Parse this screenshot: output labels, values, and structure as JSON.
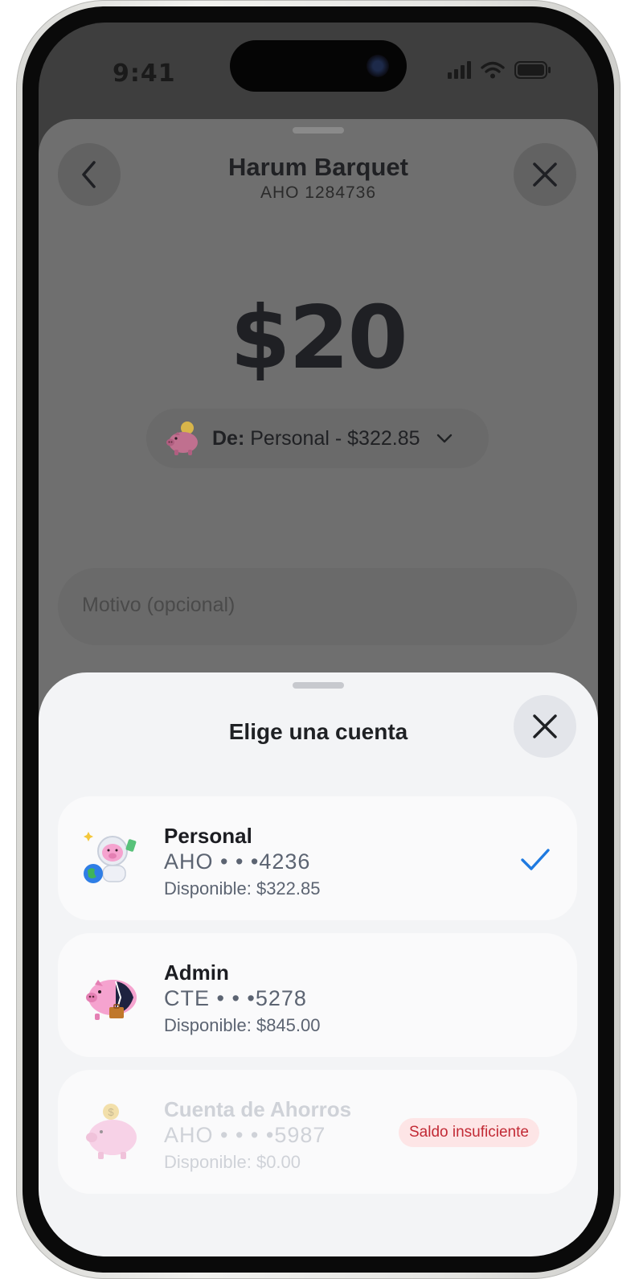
{
  "status_bar": {
    "time": "9:41"
  },
  "header": {
    "recipient_name": "Harum Barquet",
    "recipient_account": "AHO 1284736"
  },
  "transfer": {
    "amount": "$20",
    "from_prefix": "De:",
    "from_value": "Personal - $322.85"
  },
  "motivo": {
    "placeholder": "Motivo (opcional)"
  },
  "account_picker": {
    "title": "Elige una cuenta",
    "accounts": [
      {
        "name": "Personal",
        "number": "AHO • • •4236",
        "available": "Disponible: $322.85",
        "selected": true
      },
      {
        "name": "Admin",
        "number": "CTE • • •5278",
        "available": "Disponible: $845.00",
        "selected": false
      },
      {
        "name": "Cuenta de Ahorros",
        "number": "AHO • • • •5987",
        "available": "Disponible: $0.00",
        "disabled": true,
        "badge": "Saldo insuficiente"
      }
    ]
  },
  "colors": {
    "accent": "#1f7ae0",
    "error_text": "#c22a35",
    "error_bg": "#fde5e6",
    "sheet_bg": "#f3f4f6",
    "card_bg": "#fafafb",
    "pig_pink": "#f5a3cf"
  },
  "icons": [
    "chevron-left-icon",
    "close-icon",
    "chevron-down-icon",
    "check-icon",
    "signal-icon",
    "wifi-icon",
    "battery-icon",
    "piggy-bank-icon"
  ]
}
